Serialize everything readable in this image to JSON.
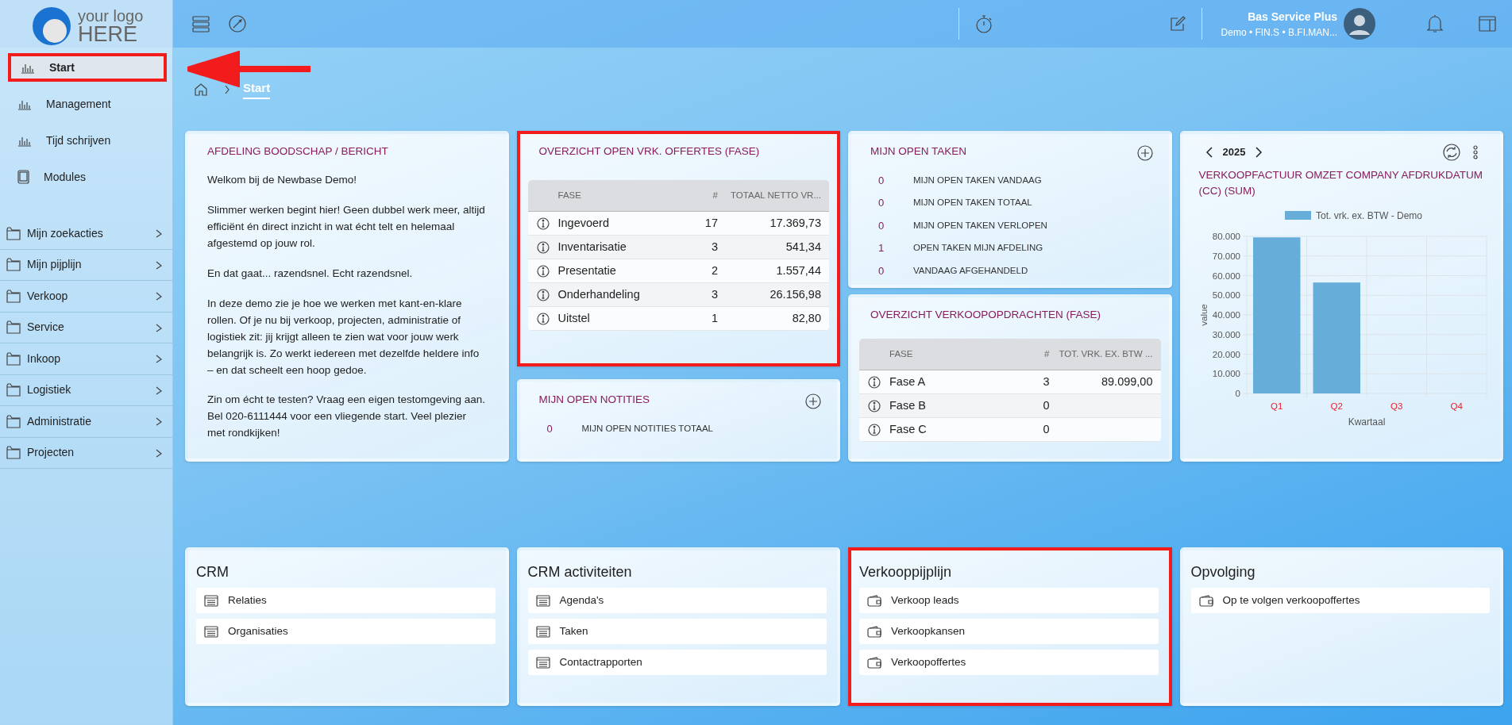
{
  "logo": {
    "line1": "your logo",
    "line2": "HERE"
  },
  "sidebar": {
    "items": [
      {
        "label": "Start",
        "kind": "chart",
        "selected": true,
        "highlighted": true
      },
      {
        "label": "Management",
        "kind": "chart",
        "selected": false,
        "highlighted": false
      },
      {
        "label": "Tijd schrijven",
        "kind": "chart",
        "selected": false,
        "highlighted": false
      },
      {
        "label": "Modules",
        "kind": "tablet",
        "selected": false,
        "highlighted": false
      }
    ],
    "folders": [
      {
        "label": "Mijn zoekacties"
      },
      {
        "label": "Mijn pijplijn"
      },
      {
        "label": "Verkoop"
      },
      {
        "label": "Service"
      },
      {
        "label": "Inkoop"
      },
      {
        "label": "Logistiek"
      },
      {
        "label": "Administratie"
      },
      {
        "label": "Projecten"
      }
    ]
  },
  "topbar": {
    "user_name": "Bas Service Plus",
    "user_details": "Demo • FIN.S • B.FI.MAN..."
  },
  "breadcrumb": {
    "current": "Start"
  },
  "message_card": {
    "title": "AFDELING BOODSCHAP / BERICHT",
    "paragraphs": [
      "Welkom bij de Newbase Demo!",
      "Slimmer werken begint hier! Geen dubbel werk meer, altijd efficiënt én direct inzicht in wat écht telt en helemaal afgestemd op jouw rol.",
      "En dat gaat... razendsnel. Echt razendsnel.",
      "In deze demo zie je hoe we werken met kant-en-klare rollen. Of je nu bij verkoop, projecten, administratie of logistiek zit: jij krijgt alleen te zien wat voor jouw werk belangrijk is. Zo werkt iedereen met dezelfde heldere info – en dat scheelt een hoop gedoe.",
      "Zin om écht te testen? Vraag een eigen testomgeving aan. Bel 020-6111444 voor een vliegende start. Veel plezier met rondkijken!"
    ]
  },
  "offertes_card": {
    "title": "OVERZICHT OPEN VRK. OFFERTES (FASE)",
    "highlighted": true,
    "columns": [
      "FASE",
      "#",
      "TOTAAL NETTO VR..."
    ],
    "rows": [
      {
        "fase": "Ingevoerd",
        "count": "17",
        "total": "17.369,73"
      },
      {
        "fase": "Inventarisatie",
        "count": "3",
        "total": "541,34"
      },
      {
        "fase": "Presentatie",
        "count": "2",
        "total": "1.557,44"
      },
      {
        "fase": "Onderhandeling",
        "count": "3",
        "total": "26.156,98"
      },
      {
        "fase": "Uitstel",
        "count": "1",
        "total": "82,80"
      }
    ]
  },
  "notities_card": {
    "title": "MIJN OPEN NOTITIES",
    "items": [
      {
        "count": "0",
        "label": "MIJN OPEN NOTITIES TOTAAL"
      }
    ]
  },
  "taken_card": {
    "title": "MIJN OPEN TAKEN",
    "items": [
      {
        "count": "0",
        "label": "MIJN OPEN TAKEN VANDAAG"
      },
      {
        "count": "0",
        "label": "MIJN OPEN TAKEN TOTAAL"
      },
      {
        "count": "0",
        "label": "MIJN OPEN TAKEN VERLOPEN"
      },
      {
        "count": "1",
        "label": "OPEN TAKEN MIJN AFDELING"
      },
      {
        "count": "0",
        "label": "VANDAAG AFGEHANDELD"
      }
    ]
  },
  "opdrachten_card": {
    "title": "OVERZICHT VERKOOPOPDRACHTEN (FASE)",
    "columns": [
      "FASE",
      "#",
      "TOT. VRK. EX. BTW ..."
    ],
    "rows": [
      {
        "fase": "Fase A",
        "count": "3",
        "total": "89.099,00"
      },
      {
        "fase": "Fase B",
        "count": "0"
      },
      {
        "fase": "Fase C",
        "count": "0"
      }
    ]
  },
  "chart_card": {
    "year": "2025",
    "title": "VERKOOPFACTUUR OMZET COMPANY AFDRUKDATUM (CC) (SUM)",
    "chart_data": {
      "type": "bar",
      "grid": true,
      "xlabel": "Kwartaal",
      "ylabel": "value",
      "categories": [
        "Q1",
        "Q2",
        "Q3",
        "Q4"
      ],
      "series": [
        {
          "name": "Tot. vrk. ex. BTW - Demo",
          "color": "#66aed9",
          "values": [
            79500,
            56500,
            0,
            0
          ]
        }
      ],
      "ylim": [
        0,
        80000
      ],
      "yticks": [
        {
          "value": 0,
          "label": "0"
        },
        {
          "value": 10000,
          "label": "10.000"
        },
        {
          "value": 20000,
          "label": "20.000"
        },
        {
          "value": 30000,
          "label": "30.000"
        },
        {
          "value": 40000,
          "label": "40.000"
        },
        {
          "value": 50000,
          "label": "50.000"
        },
        {
          "value": 60000,
          "label": "60.000"
        },
        {
          "value": 70000,
          "label": "70.000"
        },
        {
          "value": 80000,
          "label": "80.000"
        }
      ]
    }
  },
  "tile_groups": [
    {
      "title": "CRM",
      "highlighted": false,
      "links": [
        {
          "label": "Relaties",
          "kind": "list"
        },
        {
          "label": "Organisaties",
          "kind": "list"
        }
      ]
    },
    {
      "title": "CRM activiteiten",
      "highlighted": false,
      "links": [
        {
          "label": "Agenda's",
          "kind": "list"
        },
        {
          "label": "Taken",
          "kind": "list"
        },
        {
          "label": "Contactrapporten",
          "kind": "list"
        }
      ]
    },
    {
      "title": "Verkooppijplijn",
      "highlighted": true,
      "links": [
        {
          "label": "Verkoop leads",
          "kind": "wallet"
        },
        {
          "label": "Verkoopkansen",
          "kind": "wallet"
        },
        {
          "label": "Verkoopoffertes",
          "kind": "wallet"
        }
      ]
    },
    {
      "title": "Opvolging",
      "highlighted": false,
      "links": [
        {
          "label": "Op te volgen verkoopoffertes",
          "kind": "wallet"
        }
      ]
    }
  ]
}
